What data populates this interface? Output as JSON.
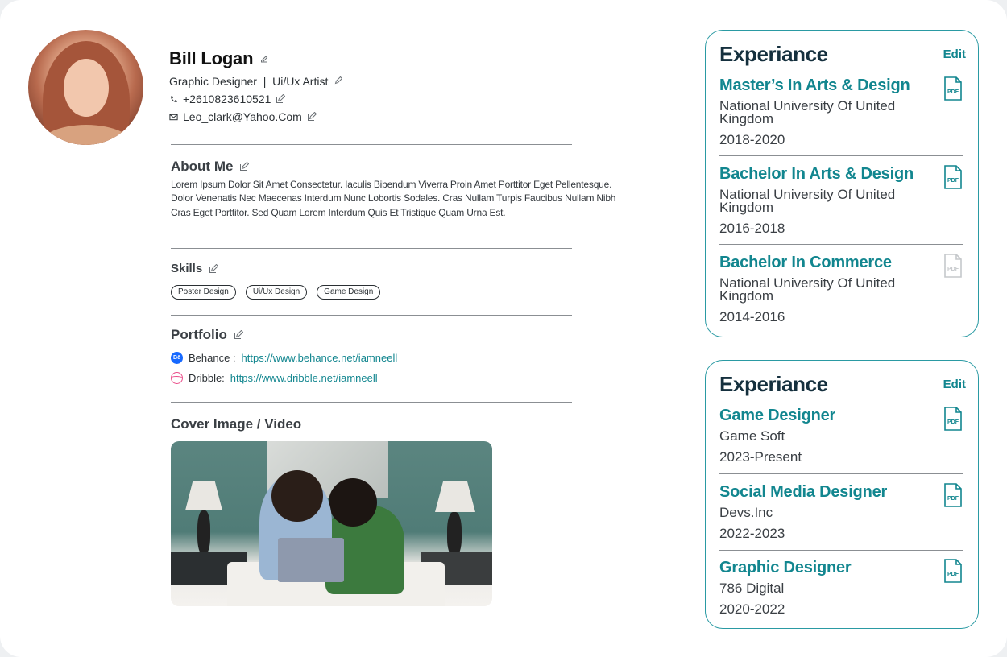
{
  "profile": {
    "name": "Bill Logan",
    "roles": "Graphic Designer  |  Ui/Ux Artist",
    "phone": "+2610823610521",
    "email": "Leo_clark@Yahoo.Com"
  },
  "about": {
    "title": "About Me",
    "text": "Lorem Ipsum Dolor Sit Amet Consectetur. Iaculis Bibendum Viverra Proin Amet Porttitor Eget Pellentesque. Dolor Venenatis Nec Maecenas Interdum Nunc Lobortis Sodales. Cras Nullam Turpis Faucibus Nullam Nibh Cras Eget Porttitor. Sed Quam Lorem Interdum Quis Et Tristique Quam Urna Est."
  },
  "skills": {
    "title": "Skills",
    "items": [
      "Poster Design",
      "Ui/Ux Design",
      "Game Design"
    ]
  },
  "portfolio": {
    "title": "Portfolio",
    "links": [
      {
        "icon": "behance-icon",
        "label": "Behance :",
        "url": "https://www.behance.net/iamneell"
      },
      {
        "icon": "dribbble-icon",
        "label": "Dribble:",
        "url": "https://www.dribble.net/iamneell"
      }
    ]
  },
  "cover": {
    "title": "Cover Image / Video"
  },
  "education_card": {
    "title": "Experiance",
    "edit_label": "Edit",
    "entries": [
      {
        "title": "Master’s In Arts & Design",
        "subtitle": "National University Of United Kingdom",
        "years": "2018-2020",
        "pdf_active": true
      },
      {
        "title": "Bachelor In Arts & Design",
        "subtitle": "National University Of United Kingdom",
        "years": "2016-2018",
        "pdf_active": true
      },
      {
        "title": "Bachelor In Commerce",
        "subtitle": "National University Of United Kingdom",
        "years": "2014-2016",
        "pdf_active": false
      }
    ]
  },
  "experience_card": {
    "title": "Experiance",
    "edit_label": "Edit",
    "entries": [
      {
        "title": "Game Designer",
        "subtitle": "Game Soft",
        "years": "2023-Present",
        "pdf_active": true
      },
      {
        "title": "Social Media Designer",
        "subtitle": "Devs.Inc",
        "years": "2022-2023",
        "pdf_active": true
      },
      {
        "title": "Graphic Designer",
        "subtitle": "786 Digital",
        "years": "2020-2022",
        "pdf_active": true
      }
    ]
  },
  "icons": {
    "pdf_label": "PDF"
  },
  "colors": {
    "accent": "#12868f",
    "card_border": "#2a9aa3",
    "heading_dark": "#15303e",
    "pdf_inactive": "#c5c8cb"
  }
}
